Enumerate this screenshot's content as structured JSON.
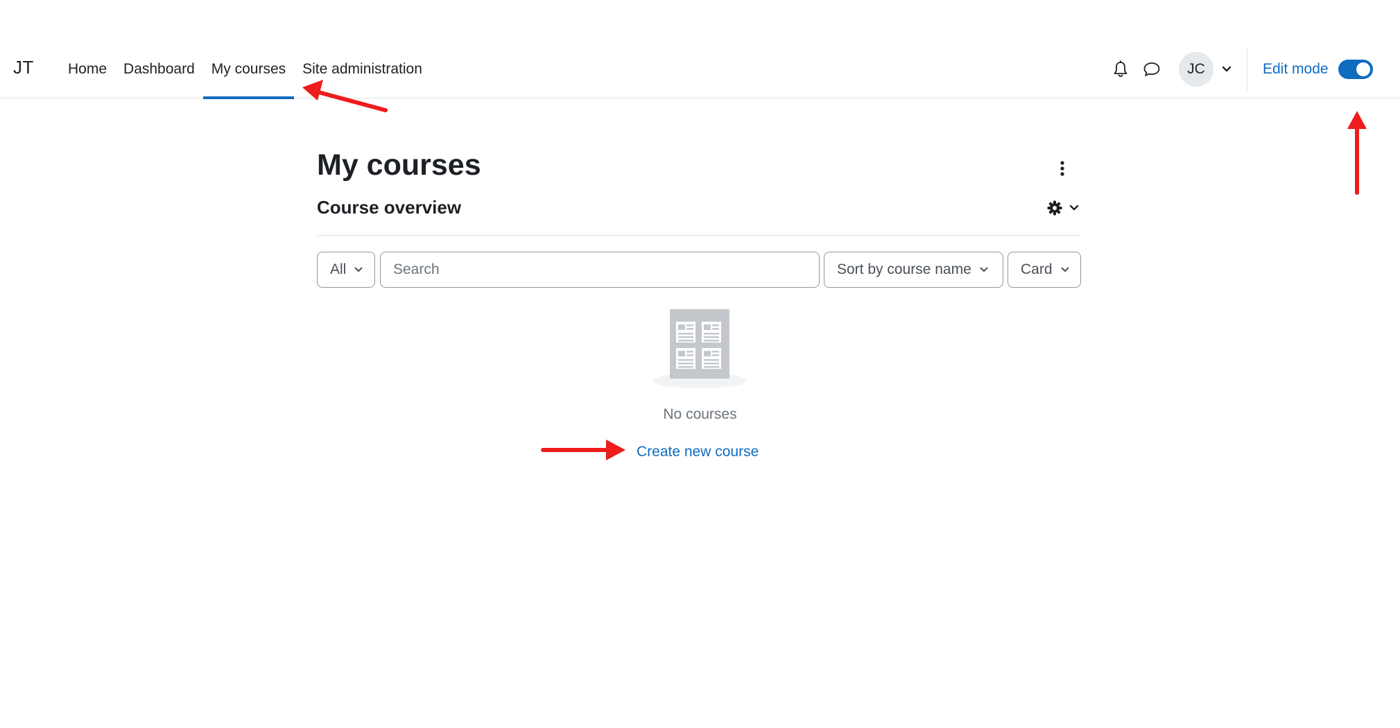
{
  "navbar": {
    "brand": "JT",
    "items": [
      {
        "label": "Home",
        "active": false
      },
      {
        "label": "Dashboard",
        "active": false
      },
      {
        "label": "My courses",
        "active": true
      },
      {
        "label": "Site administration",
        "active": false
      }
    ],
    "notifications_icon": "bell-icon",
    "messages_icon": "chat-bubble-icon",
    "user_initials": "JC",
    "edit_mode_label": "Edit mode",
    "edit_mode_on": true
  },
  "main": {
    "page_title": "My courses",
    "block_title": "Course overview",
    "filters": {
      "grouping": "All",
      "search_placeholder": "Search",
      "search_value": "",
      "sort": "Sort by course name",
      "display": "Card"
    },
    "empty_state": {
      "illustration": "courses-placeholder-icon",
      "message": "No courses",
      "link": "Create new course"
    }
  },
  "annotations": {
    "arrow_color": "#ee1c1c",
    "count": 3
  },
  "colors": {
    "brand": "#0f6cbf",
    "text": "#1d2125",
    "muted": "#6a737b",
    "border": "#8f959e"
  }
}
